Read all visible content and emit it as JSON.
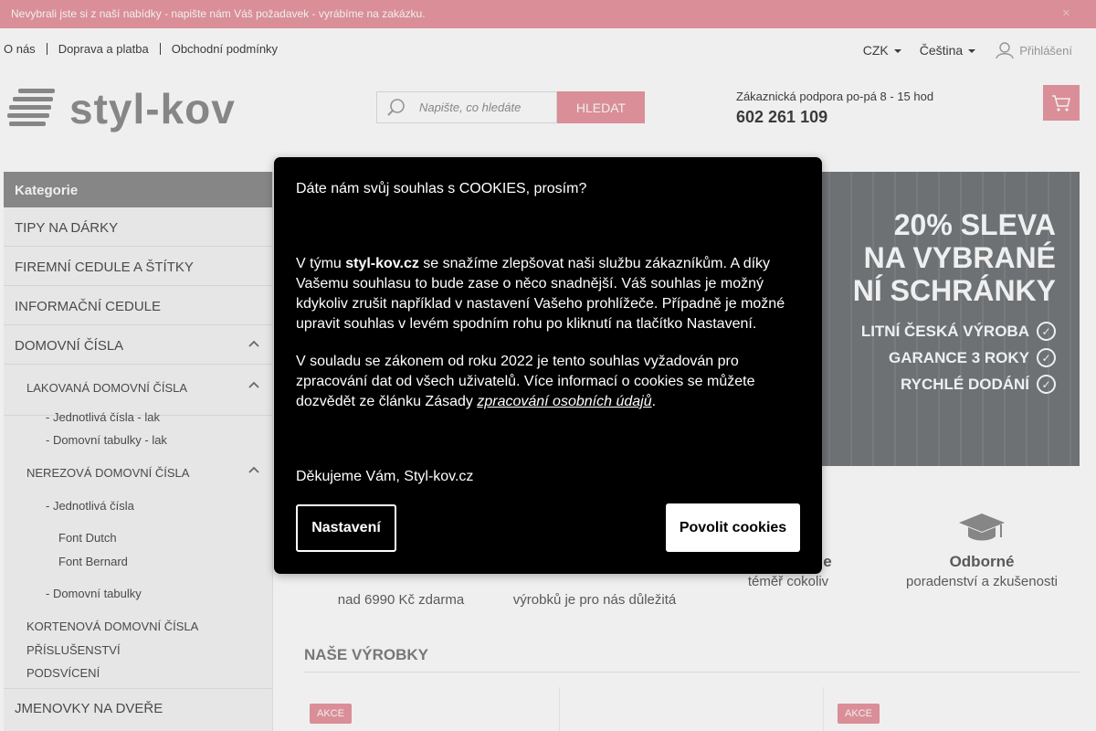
{
  "topbar": {
    "message": "Nevybrali jste si z naší nabídky - napište nám Váš požadavek - vyrábíme na zakázku.",
    "close": ""
  },
  "nav": {
    "links": [
      "O nás",
      "Doprava a platba",
      "Obchodní podmínky"
    ],
    "currency": "CZK",
    "language": "Čeština",
    "login": "Přihlášení"
  },
  "header": {
    "logo_text": "styl-kov",
    "search_placeholder": "Napište, co hledáte",
    "search_button": "HLEDAT",
    "support_label": "Zákaznická podpora po-pá 8 - 15 hod",
    "phone": "602 261 109"
  },
  "sidebar": {
    "title": "Kategorie",
    "top": [
      "TIPY NA DÁRKY",
      "FIREMNÍ CEDULE A ŠTÍTKY",
      "INFORMAČNÍ CEDULE",
      "DOMOVNÍ ČÍSLA"
    ],
    "lakovana": "LAKOVANÁ DOMOVNÍ ČÍSLA",
    "lak_items": [
      "- Jednotlivá čísla - lak",
      "- Domovní tabulky - lak"
    ],
    "nerezova": "NEREZOVÁ DOMOVNÍ ČÍSLA",
    "nerez_single": "- Jednotlivá čísla",
    "fonts": [
      "Font Dutch",
      "Font Bernard"
    ],
    "nerez_tabulky": "- Domovní tabulky",
    "others": [
      "KORTENOVÁ DOMOVNÍ ČÍSLA",
      "PŘÍSLUŠENSTVÍ",
      "PODSVÍCENÍ"
    ],
    "last": "JMENOVKY NA DVEŘE"
  },
  "banner": {
    "headline": [
      "20% SLEVA",
      "NA VYBRANÉ",
      "NÍ SCHRÁNKY"
    ],
    "bullets": [
      "LITNÍ ČESKÁ VÝROBA",
      "GARANCE 3 ROKY",
      "RYCHLÉ DODÁNÍ"
    ]
  },
  "features": [
    {
      "title": "",
      "desc": "nad 6990 Kč zdarma"
    },
    {
      "title": "",
      "desc": "výrobků je pro nás důležitá"
    },
    {
      "title": "e",
      "desc": "téměř cokoliv"
    },
    {
      "title": "Odborné",
      "desc": "poradenství a zkušenosti"
    }
  ],
  "products": {
    "title": "NAŠE VÝROBKY",
    "badge": "AKCE"
  },
  "cookie": {
    "heading": "Dáte nám svůj souhlas s COOKIES, prosím?",
    "p1_pre": "V týmu ",
    "p1_brand": "styl-kov.cz",
    "p1_post": " se snažíme zlepšovat naši službu zákazníkům. A díky Vašemu souhlasu to bude zase o něco snadnější. Váš souhlas je možný kdykoliv zrušit například v nastavení Vašeho prohlížeče. Případně je možné upravit souhlas v levém spodním rohu po kliknutí na tlačítko Nastavení.",
    "p2_pre": "V souladu se zákonem od roku 2022 je tento souhlas vyžadován pro zpracování dat od všech uživatelů. Více informací o cookies se můžete dozvědět ze článku Zásady ",
    "p2_link": "zpracování osobních údajů",
    "p2_post": ".",
    "thanks": "Děkujeme Vám, Styl-kov.cz",
    "settings_button": "Nastavení",
    "allow_button": "Povolit cookies"
  },
  "colors": {
    "accent": "#e8919b",
    "modal_bg": "#000000"
  }
}
